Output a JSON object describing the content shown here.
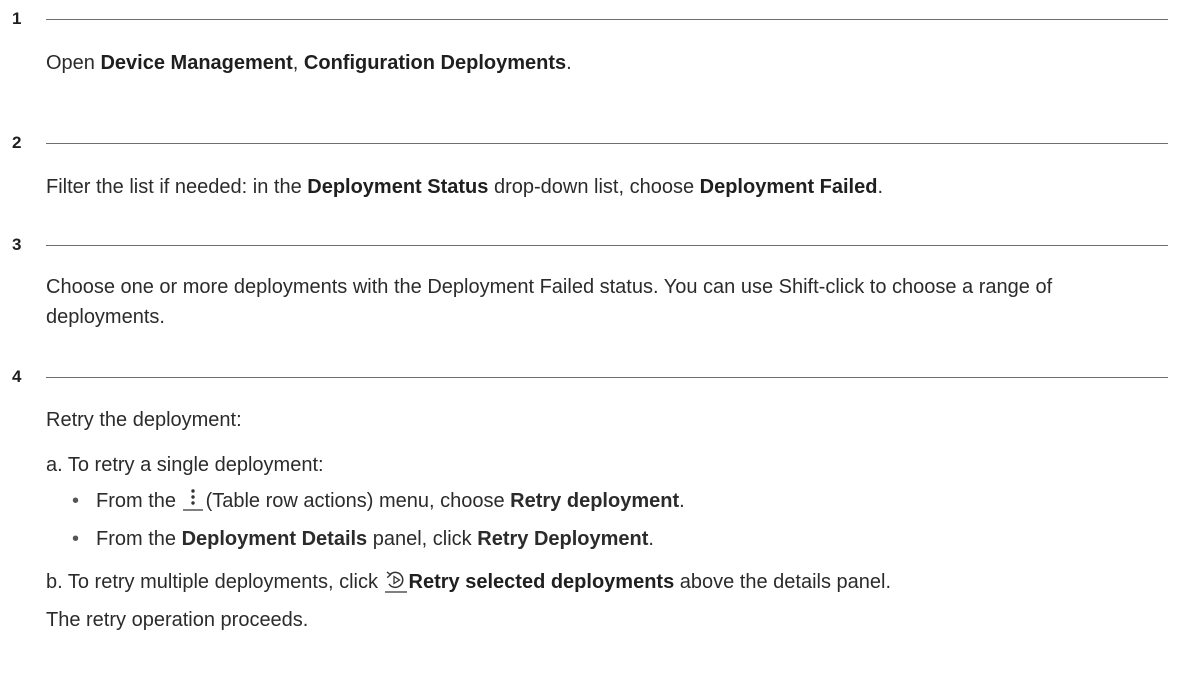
{
  "steps": [
    {
      "number": "1"
    },
    {
      "number": "2"
    },
    {
      "number": "3"
    },
    {
      "number": "4"
    }
  ],
  "step1": {
    "open": "Open ",
    "device_management": "Device Management",
    "sep": ", ",
    "config_deployments": "Configuration Deployments",
    "end": "."
  },
  "step2": {
    "lead": "Filter the list if needed: in the ",
    "deployment_status": "Deployment Status",
    "mid": " drop-down list, choose ",
    "deployment_failed": "Deployment Failed",
    "end": "."
  },
  "step3": {
    "text": "Choose one or more deployments with the Deployment Failed status. You can use Shift-click to choose a range of deployments."
  },
  "step4": {
    "intro": "Retry the deployment:",
    "a_label": "a. To retry a single deployment:",
    "bullet1_lead": "From the ",
    "bullet1_menu": "(Table row actions) menu, choose ",
    "bullet1_action": "Retry deployment",
    "bullet1_end": ".",
    "bullet2_lead": "From the ",
    "bullet2_panel": "Deployment Details",
    "bullet2_mid": " panel, click ",
    "bullet2_action": "Retry Deployment",
    "bullet2_end": ".",
    "b_lead": "b. To retry multiple deployments, click ",
    "b_action": "Retry selected deployments",
    "b_end": " above the details panel.",
    "result": "The retry operation proceeds."
  },
  "icons": {
    "row_actions": "kebab-menu-icon",
    "retry": "retry-icon"
  },
  "colors": {
    "text": "#2b2b2b",
    "rule": "#6f6f6f"
  }
}
